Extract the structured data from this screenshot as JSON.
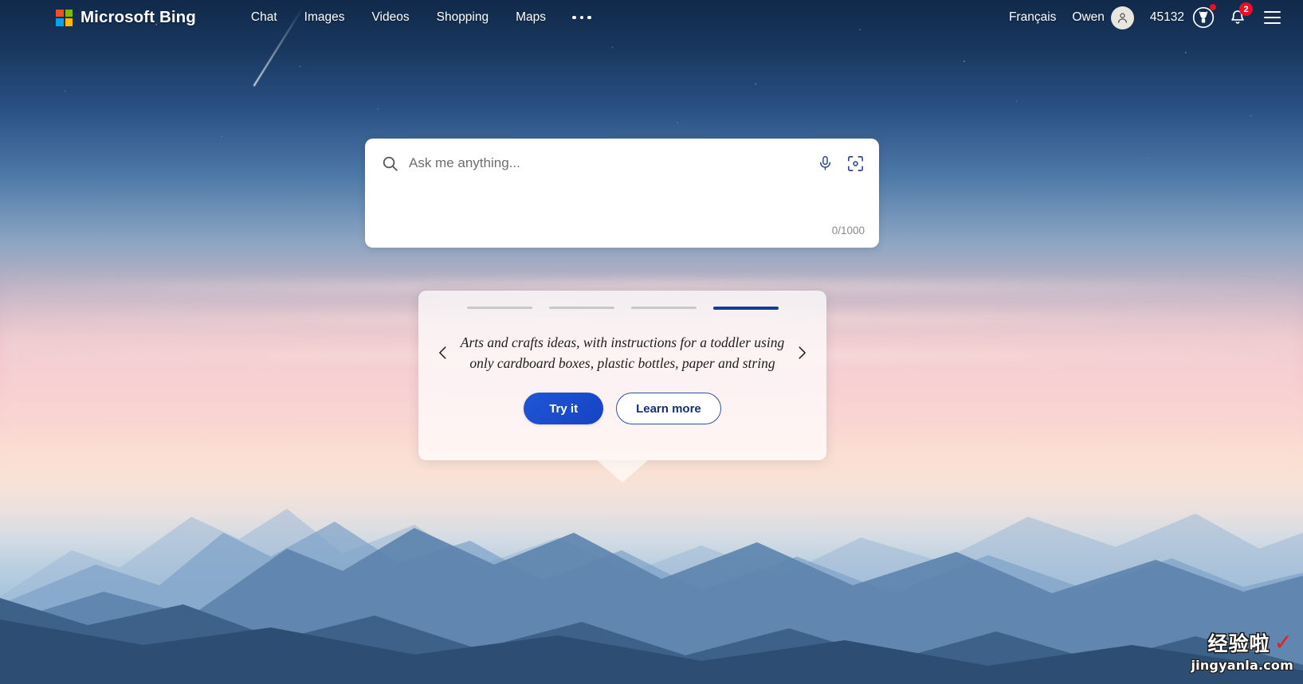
{
  "header": {
    "brand": "Microsoft Bing",
    "logo_colors": [
      "#f25022",
      "#7fba00",
      "#00a4ef",
      "#ffb900"
    ],
    "nav": [
      {
        "label": "Chat",
        "name": "nav-chat"
      },
      {
        "label": "Images",
        "name": "nav-images"
      },
      {
        "label": "Videos",
        "name": "nav-videos"
      },
      {
        "label": "Shopping",
        "name": "nav-shopping"
      },
      {
        "label": "Maps",
        "name": "nav-maps"
      }
    ],
    "more_menu": "more-menu",
    "language": "Français",
    "account_name": "Owen",
    "rewards_points": "45132",
    "notification_count": "2",
    "icons": {
      "avatar": "person-icon",
      "rewards": "rewards-medal-icon",
      "notifications": "bell-icon",
      "menu": "hamburger-menu-icon"
    }
  },
  "search": {
    "placeholder": "Ask me anything...",
    "value": "",
    "char_count": "0/1000",
    "icons": {
      "search": "search-icon",
      "microphone": "microphone-icon",
      "visual_search": "visual-search-camera-icon"
    }
  },
  "suggestion": {
    "text": "Arts and crafts ideas, with instructions for a toddler using only cardboard boxes, plastic bottles, paper and string",
    "try_label": "Try it",
    "learn_label": "Learn more",
    "prev_icon": "chevron-left-icon",
    "next_icon": "chevron-right-icon",
    "pips_total": 4,
    "pips_active_index": 3,
    "accent_color": "#17399b"
  },
  "watermark": {
    "title": "经验啦",
    "check": "✓",
    "url": "jingyanla.com"
  }
}
